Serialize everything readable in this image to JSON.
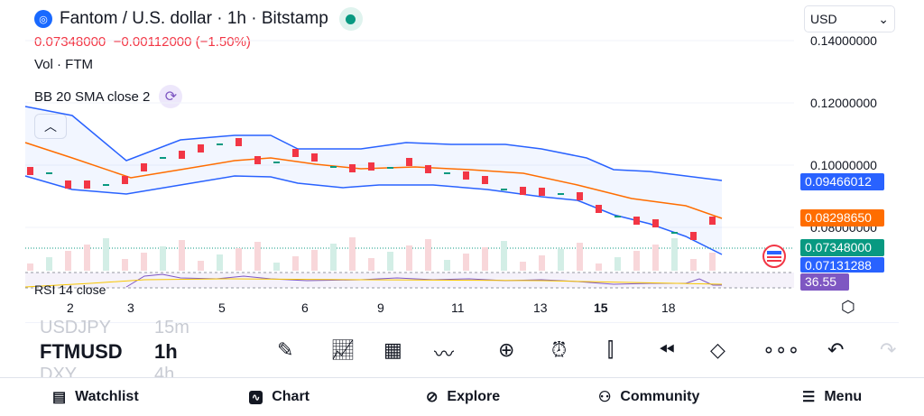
{
  "header": {
    "title": "Fantom / U.S. dollar · 1h · Bitstamp",
    "logo": "fantom-logo",
    "price_line": "0.07348000  −0.00112000 (−1.50%)",
    "vol_label": "Vol · FTM",
    "bb_label": "BB 20 SMA close 2",
    "rsi_label": "RSI 14 close"
  },
  "currency": {
    "selected": "USD"
  },
  "price_axis": [
    "0.14000000",
    "0.12000000",
    "0.10000000",
    "0.08000000"
  ],
  "tags": {
    "bb_upper": "0.09466012",
    "bb_basis": "0.08298650",
    "last": "0.07348000",
    "bb_lower": "0.07131288",
    "rsi": "36.55"
  },
  "colors": {
    "up": "#089981",
    "down": "#f23645",
    "upper": "#2962ff",
    "basis": "#ff6d00",
    "rsi": "#7e57c2"
  },
  "time_axis": [
    "2",
    "3",
    "5",
    "6",
    "9",
    "11",
    "13",
    "15",
    "18"
  ],
  "symbols": {
    "prev": "USDJPY",
    "prev_tf": "15m",
    "current": "FTMUSD",
    "current_tf": "1h",
    "next": "DXY",
    "next_tf": "4h"
  },
  "nav": [
    "Watchlist",
    "Chart",
    "Explore",
    "Community",
    "Menu"
  ]
}
